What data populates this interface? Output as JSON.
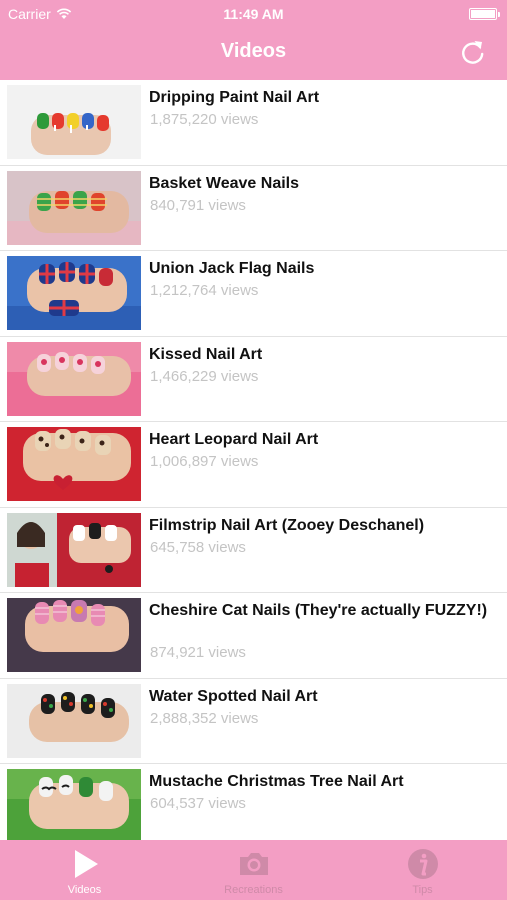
{
  "status_bar": {
    "carrier": "Carrier",
    "time": "11:49 AM"
  },
  "nav": {
    "title": "Videos"
  },
  "videos": [
    {
      "title": "Dripping Paint Nail Art",
      "views": "1,875,220 views"
    },
    {
      "title": "Basket Weave Nails",
      "views": "840,791 views"
    },
    {
      "title": "Union Jack Flag Nails",
      "views": "1,212,764 views"
    },
    {
      "title": "Kissed Nail Art",
      "views": "1,466,229 views"
    },
    {
      "title": "Heart Leopard Nail Art",
      "views": "1,006,897 views"
    },
    {
      "title": "Filmstrip Nail Art (Zooey Deschanel)",
      "views": "645,758 views"
    },
    {
      "title": "Cheshire Cat Nails (They're actually FUZZY!)",
      "views": "874,921 views"
    },
    {
      "title": "Water Spotted Nail Art",
      "views": "2,888,352 views"
    },
    {
      "title": "Mustache Christmas Tree Nail Art",
      "views": "604,537 views"
    }
  ],
  "tabs": [
    {
      "label": "Videos",
      "icon": "play-icon",
      "active": true
    },
    {
      "label": "Recreations",
      "icon": "camera-icon",
      "active": false
    },
    {
      "label": "Tips",
      "icon": "info-icon",
      "active": false
    }
  ],
  "colors": {
    "accent": "#f39ec4",
    "views_text": "#c4c4c4",
    "inactive_tab": "#cf8aa8"
  }
}
